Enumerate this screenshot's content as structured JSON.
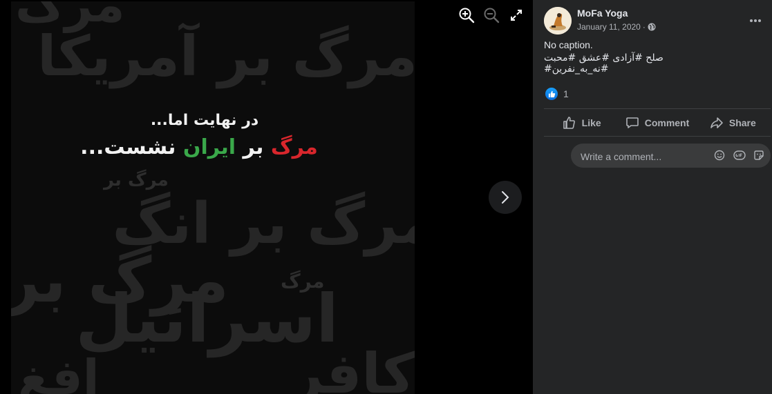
{
  "viewer": {
    "image_headline_line1": "در نهایت اما...",
    "image_headline_line2": {
      "word1": "مرگ",
      "word2": "بر",
      "word3": "ایران",
      "word4": "نشست..."
    },
    "background_words": [
      "مرگ بر آمریکا",
      "مرگ بر انگ",
      "مرگ بر",
      "اسرائیل",
      "مرگ",
      "مرگ",
      "کافر",
      "مرگ بر",
      "افغ"
    ],
    "icons": {
      "zoom_in": "zoom-in-icon",
      "zoom_out": "zoom-out-icon",
      "fullscreen": "fullscreen-icon",
      "next": "chevron-right-icon"
    },
    "colors": {
      "red": "#d8262c",
      "green": "#3aa84a",
      "white": "#f2f2f2"
    }
  },
  "post": {
    "author": "MoFa Yoga",
    "date": "January 11, 2020",
    "date_separator": "·",
    "caption": "No caption.",
    "hashtags": "صلح #آزادی #عشق #محبت #نه_به_نفرین#",
    "reaction_count": "1"
  },
  "actions": {
    "like": "Like",
    "comment": "Comment",
    "share": "Share"
  },
  "comment_box": {
    "placeholder": "Write a comment..."
  },
  "theme": {
    "sidebar_bg": "#242526",
    "text_primary": "#e4e6eb",
    "text_secondary": "#b0b3b8",
    "like_blue": "#1877f2"
  }
}
